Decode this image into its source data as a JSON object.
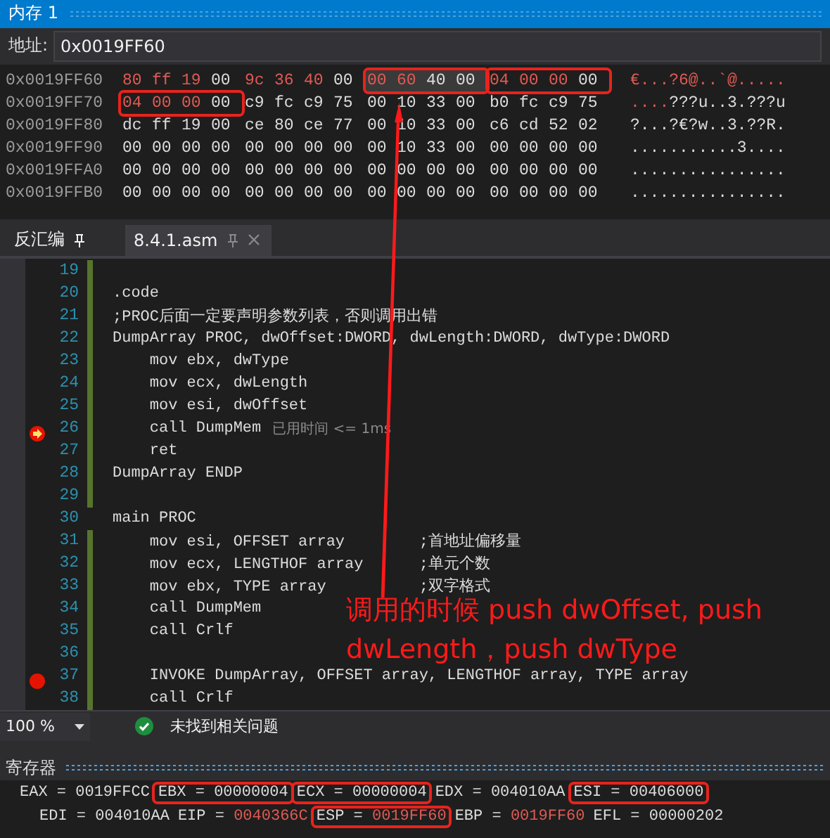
{
  "memory": {
    "title": "内存 1",
    "address_label": "地址:",
    "address": "0x0019FF60",
    "rows": [
      {
        "addr": "0x0019FF60",
        "groups": [
          {
            "bytes": "80 ff 19 00",
            "changed": [
              true,
              true,
              true,
              false
            ],
            "boxed": false,
            "selected": false
          },
          {
            "bytes": "9c 36 40 00",
            "changed": [
              true,
              true,
              true,
              false
            ],
            "boxed": false,
            "selected": false
          },
          {
            "bytes": "00 60 40 00",
            "changed": [
              true,
              true,
              false,
              false
            ],
            "boxed": true,
            "selected": true
          },
          {
            "bytes": "04 00 00 00",
            "changed": [
              true,
              true,
              true,
              false
            ],
            "boxed": true,
            "selected": false
          }
        ],
        "ascii": [
          {
            "t": "€...?6@..`@.....",
            "changed": true
          }
        ]
      },
      {
        "addr": "0x0019FF70",
        "groups": [
          {
            "bytes": "04 00 00 00",
            "changed": [
              true,
              true,
              true,
              false
            ],
            "boxed": true,
            "selected": false
          },
          {
            "bytes": "c9 fc c9 75",
            "changed": [
              false,
              false,
              false,
              false
            ],
            "boxed": false,
            "selected": false
          },
          {
            "bytes": "00 10 33 00",
            "changed": [
              false,
              false,
              false,
              false
            ],
            "boxed": false,
            "selected": false
          },
          {
            "bytes": "b0 fc c9 75",
            "changed": [
              false,
              false,
              false,
              false
            ],
            "boxed": false,
            "selected": false
          }
        ],
        "ascii": [
          {
            "t": "....",
            "changed": true
          },
          {
            "t": "???u..3.???u",
            "changed": false
          }
        ]
      },
      {
        "addr": "0x0019FF80",
        "groups": [
          {
            "bytes": "dc ff 19 00",
            "changed": [
              false,
              false,
              false,
              false
            ],
            "boxed": false,
            "selected": false
          },
          {
            "bytes": "ce 80 ce 77",
            "changed": [
              false,
              false,
              false,
              false
            ],
            "boxed": false,
            "selected": false
          },
          {
            "bytes": "00 10 33 00",
            "changed": [
              false,
              false,
              false,
              false
            ],
            "boxed": false,
            "selected": false
          },
          {
            "bytes": "c6 cd 52 02",
            "changed": [
              false,
              false,
              false,
              false
            ],
            "boxed": false,
            "selected": false
          }
        ],
        "ascii": [
          {
            "t": "?...?€?w..3.??R.",
            "changed": false
          }
        ]
      },
      {
        "addr": "0x0019FF90",
        "groups": [
          {
            "bytes": "00 00 00 00",
            "changed": [
              false,
              false,
              false,
              false
            ],
            "boxed": false,
            "selected": false
          },
          {
            "bytes": "00 00 00 00",
            "changed": [
              false,
              false,
              false,
              false
            ],
            "boxed": false,
            "selected": false
          },
          {
            "bytes": "00 10 33 00",
            "changed": [
              false,
              false,
              false,
              false
            ],
            "boxed": false,
            "selected": false
          },
          {
            "bytes": "00 00 00 00",
            "changed": [
              false,
              false,
              false,
              false
            ],
            "boxed": false,
            "selected": false
          }
        ],
        "ascii": [
          {
            "t": "...........3....",
            "changed": false
          }
        ]
      },
      {
        "addr": "0x0019FFA0",
        "groups": [
          {
            "bytes": "00 00 00 00",
            "changed": [
              false,
              false,
              false,
              false
            ],
            "boxed": false,
            "selected": false
          },
          {
            "bytes": "00 00 00 00",
            "changed": [
              false,
              false,
              false,
              false
            ],
            "boxed": false,
            "selected": false
          },
          {
            "bytes": "00 00 00 00",
            "changed": [
              false,
              false,
              false,
              false
            ],
            "boxed": false,
            "selected": false
          },
          {
            "bytes": "00 00 00 00",
            "changed": [
              false,
              false,
              false,
              false
            ],
            "boxed": false,
            "selected": false
          }
        ],
        "ascii": [
          {
            "t": "................",
            "changed": false
          }
        ]
      },
      {
        "addr": "0x0019FFB0",
        "groups": [
          {
            "bytes": "00 00 00 00",
            "changed": [
              false,
              false,
              false,
              false
            ],
            "boxed": false,
            "selected": false
          },
          {
            "bytes": "00 00 00 00",
            "changed": [
              false,
              false,
              false,
              false
            ],
            "boxed": false,
            "selected": false
          },
          {
            "bytes": "00 00 00 00",
            "changed": [
              false,
              false,
              false,
              false
            ],
            "boxed": false,
            "selected": false
          },
          {
            "bytes": "00 00 00 00",
            "changed": [
              false,
              false,
              false,
              false
            ],
            "boxed": false,
            "selected": false
          }
        ],
        "ascii": [
          {
            "t": "................",
            "changed": false
          }
        ]
      }
    ]
  },
  "editor": {
    "tabs": [
      {
        "label": "反汇编",
        "selected": false,
        "closable": false
      },
      {
        "label": "8.4.1.asm",
        "selected": true,
        "closable": true
      }
    ],
    "lines": [
      {
        "n": "19",
        "modified": true,
        "breakpoint": false,
        "current": false
      },
      {
        "n": "20",
        "text": ".code",
        "modified": true,
        "breakpoint": false,
        "current": false
      },
      {
        "n": "21",
        "text": ";PROC后面一定要声明参数列表，否则调用出错",
        "modified": true,
        "breakpoint": false,
        "current": false
      },
      {
        "n": "22",
        "text": "DumpArray PROC, dwOffset:DWORD, dwLength:DWORD, dwType:DWORD",
        "modified": true,
        "breakpoint": false,
        "current": false
      },
      {
        "n": "23",
        "text": "    mov ebx, dwType",
        "modified": true,
        "breakpoint": false,
        "current": false
      },
      {
        "n": "24",
        "text": "    mov ecx, dwLength",
        "modified": true,
        "breakpoint": false,
        "current": false
      },
      {
        "n": "25",
        "text": "    mov esi, dwOffset",
        "modified": true,
        "breakpoint": false,
        "current": false
      },
      {
        "n": "26",
        "text": "    call DumpMem",
        "modified": true,
        "breakpoint": false,
        "current": true,
        "hint": "已用时间 <= 1ms"
      },
      {
        "n": "27",
        "text": "    ret",
        "modified": true,
        "breakpoint": false,
        "current": false
      },
      {
        "n": "28",
        "text": "DumpArray ENDP",
        "modified": true,
        "breakpoint": false,
        "current": false
      },
      {
        "n": "29",
        "modified": true,
        "breakpoint": false,
        "current": false
      },
      {
        "n": "30",
        "text": "main PROC",
        "modified": false,
        "breakpoint": false,
        "current": false
      },
      {
        "n": "31",
        "text": "    mov esi, OFFSET array        ;首地址偏移量",
        "modified": true,
        "breakpoint": false,
        "current": false
      },
      {
        "n": "32",
        "text": "    mov ecx, LENGTHOF array      ;单元个数",
        "modified": true,
        "breakpoint": false,
        "current": false
      },
      {
        "n": "33",
        "text": "    mov ebx, TYPE array          ;双字格式",
        "modified": true,
        "breakpoint": false,
        "current": false
      },
      {
        "n": "34",
        "text": "    call DumpMem",
        "modified": true,
        "breakpoint": false,
        "current": false
      },
      {
        "n": "35",
        "text": "    call Crlf",
        "modified": true,
        "breakpoint": false,
        "current": false
      },
      {
        "n": "36",
        "modified": true,
        "breakpoint": false,
        "current": false
      },
      {
        "n": "37",
        "text": "    INVOKE DumpArray, OFFSET array, LENGTHOF array, TYPE array",
        "modified": true,
        "breakpoint": true,
        "current": false
      },
      {
        "n": "38",
        "text": "    call Crlf",
        "modified": true,
        "breakpoint": false,
        "current": false
      }
    ],
    "zoom": "100 %",
    "status": "未找到相关问题"
  },
  "annotation": {
    "text": "调用的时候 push dwOffset, push dwLength，push dwType"
  },
  "registers": {
    "title": "寄存器",
    "first_line": [
      {
        "name": "EAX =",
        "value": "0019FFCC",
        "changed": false,
        "boxed": false
      },
      {
        "name": "EBX =",
        "value": "00000004",
        "changed": false,
        "boxed": true
      },
      {
        "name": "ECX =",
        "value": "00000004",
        "changed": false,
        "boxed": true
      },
      {
        "name": "EDX =",
        "value": "004010AA",
        "changed": false,
        "boxed": false
      },
      {
        "name": "ESI =",
        "value": "00406000",
        "changed": false,
        "boxed": true
      }
    ],
    "second_line": [
      {
        "name": "EDI =",
        "value": "004010AA",
        "changed": false,
        "boxed": false
      },
      {
        "name": "EIP =",
        "value": "0040366C",
        "changed": true,
        "boxed": false
      },
      {
        "name": "ESP =",
        "value": "0019FF60",
        "changed": true,
        "boxed": true
      },
      {
        "name": "EBP =",
        "value": "0019FF60",
        "changed": true,
        "boxed": false
      },
      {
        "name": "EFL =",
        "value": "00000202",
        "changed": false,
        "boxed": false
      }
    ]
  }
}
